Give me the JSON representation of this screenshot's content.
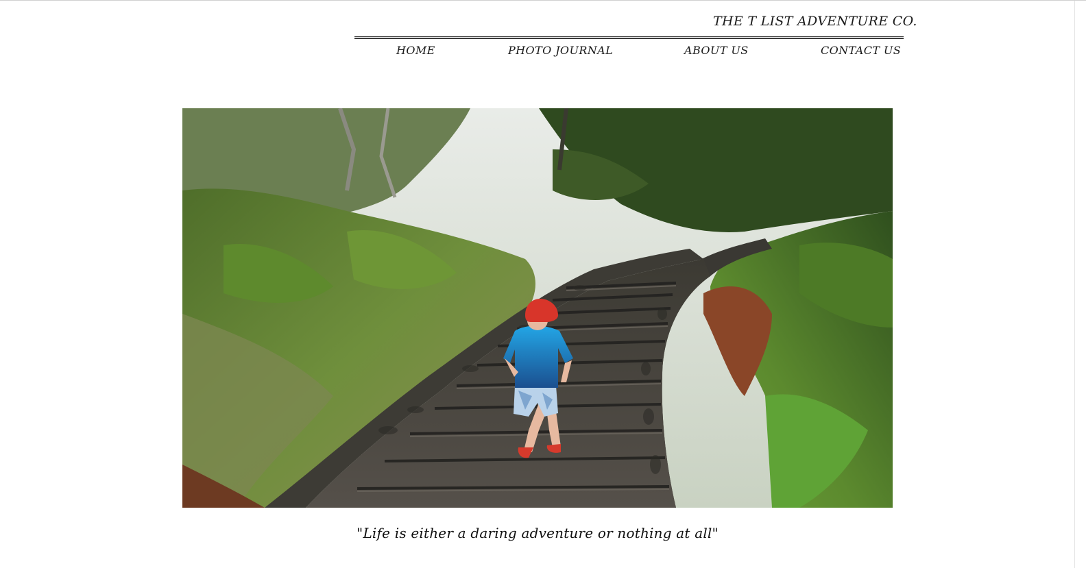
{
  "header": {
    "site_title": "THE T LIST ADVENTURE CO."
  },
  "nav": {
    "items": [
      {
        "label": "HOME"
      },
      {
        "label": "PHOTO JOURNAL"
      },
      {
        "label": "ABOUT US"
      },
      {
        "label": "CONTACT US"
      }
    ]
  },
  "hero": {
    "image_alt": "Child in a red cap and blue shirt climbing stone stairs through green brush"
  },
  "quote": {
    "text": "\"Life is either a daring adventure or nothing at all\""
  },
  "colors": {
    "text": "#1a1a1a",
    "rule": "#3a3a3a",
    "foliage": "#5d7a3a",
    "stone": "#4a453e",
    "shirt": "#1e8fd0",
    "cap": "#d8352a"
  }
}
